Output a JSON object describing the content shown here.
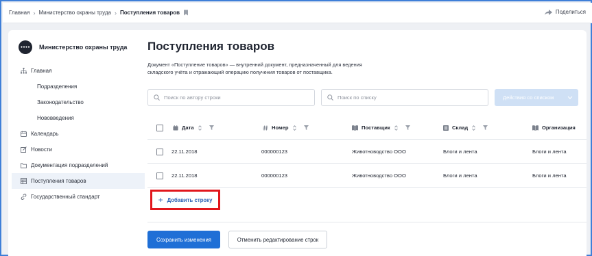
{
  "breadcrumb": {
    "items": [
      "Главная",
      "Министерство охраны труда"
    ],
    "current": "Поступления товаров",
    "separator": "›"
  },
  "share": {
    "label": "Поделиться"
  },
  "org": {
    "name": "Министерство охраны труда",
    "logo_text": "●●●●"
  },
  "nav": {
    "items": [
      {
        "label": "Главная",
        "icon": "hierarchy-icon"
      },
      {
        "label": "Подразделения"
      },
      {
        "label": "Законодательство"
      },
      {
        "label": "Нововведения"
      },
      {
        "label": "Календарь",
        "icon": "calendar-icon"
      },
      {
        "label": "Новости",
        "icon": "edit-icon"
      },
      {
        "label": "Документация подразделений",
        "icon": "folder-icon"
      },
      {
        "label": "Поступления товаров",
        "icon": "table-icon",
        "active": true
      },
      {
        "label": "Государственный стандарт",
        "icon": "link-icon"
      }
    ]
  },
  "page": {
    "title": "Поступления товаров",
    "description": "Документ «Поступление товаров» — внутренний документ, предназначенный для ведения складского учёта и отражающий операцию получения товаров от поставщика."
  },
  "search": {
    "by_author_placeholder": "Поиск по автору строки",
    "by_list_placeholder": "Поиск по списку"
  },
  "actions": {
    "label": "Действия со списком"
  },
  "table": {
    "columns": [
      {
        "label": "Дата",
        "icon": "calendar-icon"
      },
      {
        "label": "Номер",
        "icon": "hash-icon"
      },
      {
        "label": "Поставщик",
        "icon": "book-icon"
      },
      {
        "label": "Склад",
        "icon": "list-icon"
      },
      {
        "label": "Организация",
        "icon": "book-icon"
      }
    ],
    "rows": [
      [
        "22.11.2018",
        "000000123",
        "Животноводство ООО",
        "Блоги и лента",
        "Блоги и лента"
      ],
      [
        "22.11.2018",
        "000000123",
        "Животноводство ООО",
        "Блоги и лента",
        "Блоги и лента"
      ]
    ]
  },
  "add_row": {
    "label": "Добавить строку"
  },
  "buttons": {
    "save": "Сохранить изменения",
    "cancel": "Отменить редактирование строк"
  },
  "colors": {
    "accent": "#1f6fd6",
    "link": "#2c62b5",
    "highlight": "#e1161c",
    "disabled_button": "#cfe0f5"
  }
}
